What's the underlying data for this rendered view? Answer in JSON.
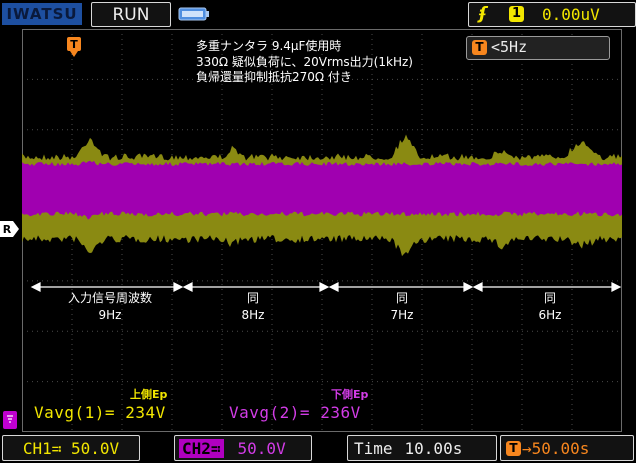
{
  "header": {
    "brand": "IWATSU",
    "run_state": "RUN",
    "trigger_channel": "1",
    "trigger_level": "0.00uV"
  },
  "title_lines": [
    "多重ナンタラ 9.4μF使用時",
    "330Ω 疑似負荷に、20Vrms出力(1kHz)",
    "負帰還量抑制抵抗270Ω 付き"
  ],
  "frequency_readout": "<5Hz",
  "markers": {
    "trigger_marker": "T",
    "ref_marker": "R"
  },
  "segments": [
    {
      "label": "入力信号周波数",
      "freq": "9Hz"
    },
    {
      "label": "同",
      "freq": "8Hz"
    },
    {
      "label": "同",
      "freq": "7Hz"
    },
    {
      "label": "同",
      "freq": "6Hz"
    }
  ],
  "measurements": {
    "ch1_caption": "上側Ep",
    "ch1_value": "Vavg(1)= 234V",
    "ch2_caption": "下側Ep",
    "ch2_value": "Vavg(2)= 236V"
  },
  "footer": {
    "ch1_scale": "CH1≕ 50.0V",
    "ch2_label": "CH2≕",
    "ch2_scale": "50.0V",
    "time_label": "Time",
    "time_value": "10.00s",
    "delay": "→50.00s",
    "delay_badge": "T"
  },
  "colors": {
    "ch1": "#8a8a12",
    "ch1_text": "#f2e600",
    "ch2": "#a000b0",
    "ch2_text": "#d23ce6",
    "trigger_marker": "#f7861e",
    "grid": "#4a4a4a"
  }
}
